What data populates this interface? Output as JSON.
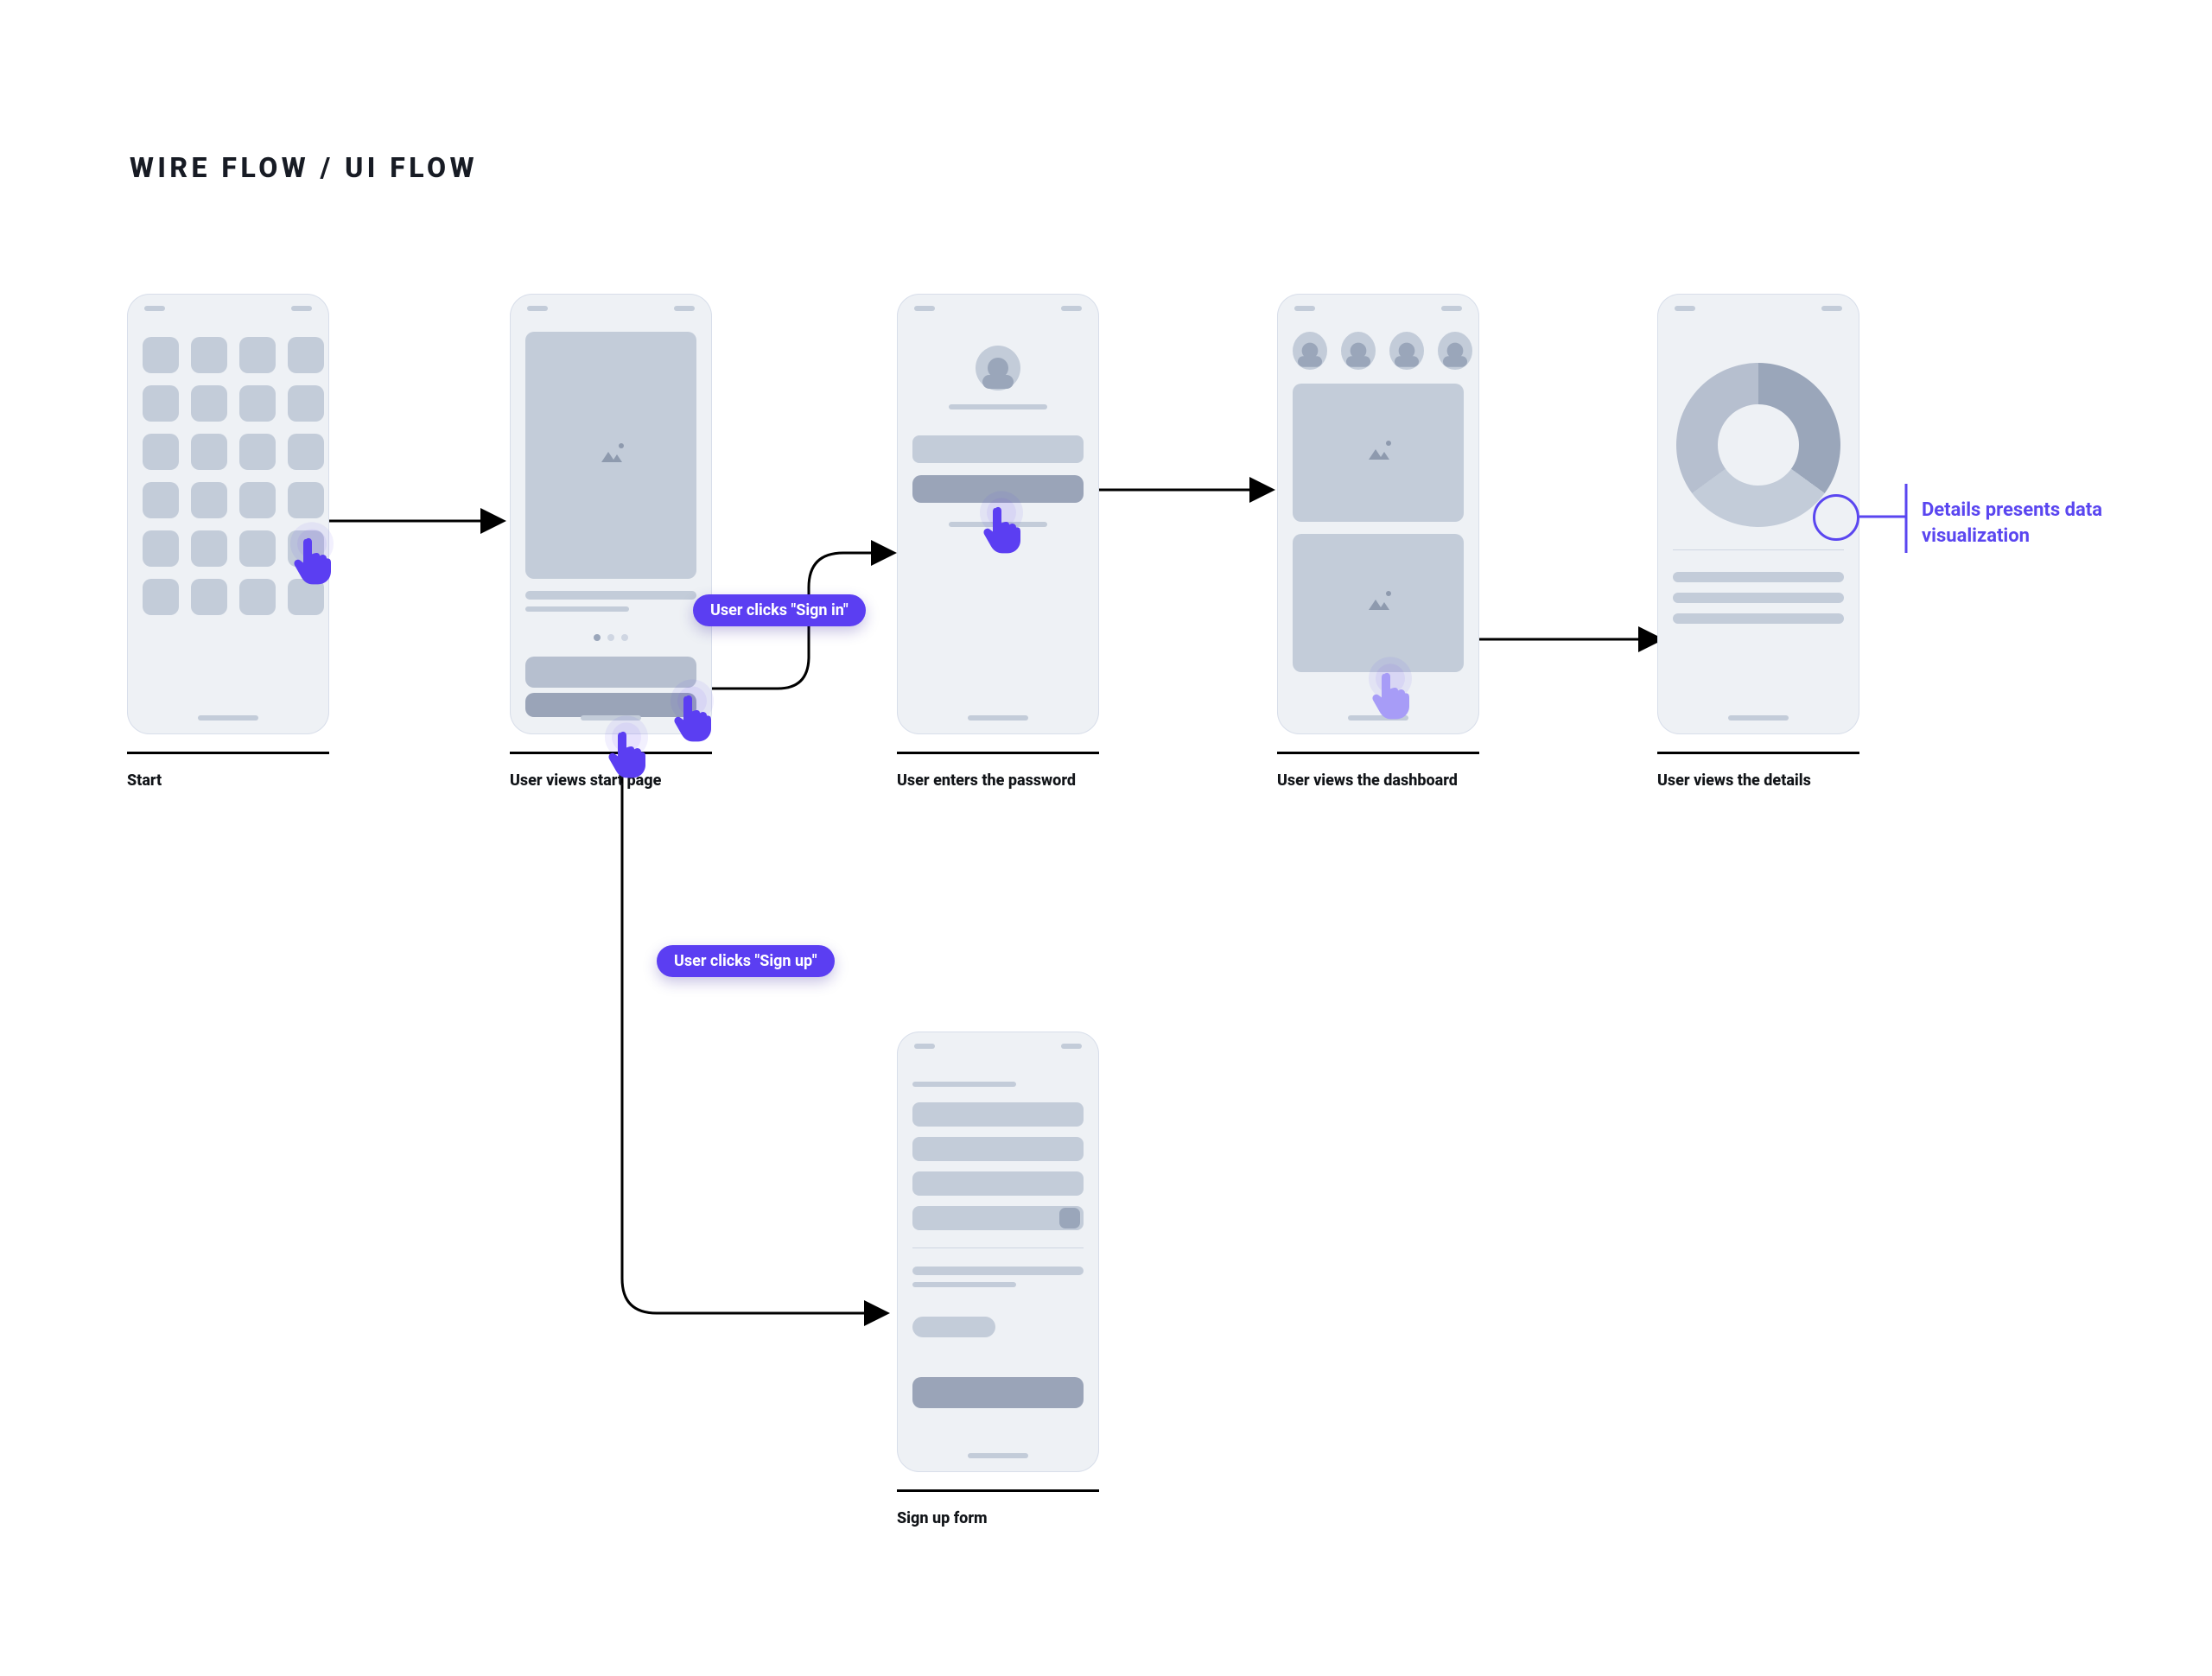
{
  "title": "WIRE FLOW / UI FLOW",
  "chips": {
    "signin": "User clicks \"Sign in\"",
    "signup": "User clicks \"Sign up\""
  },
  "annotation": "Details presents data visualization",
  "captions": {
    "start": "Start",
    "views_start": "User views start page",
    "enter_pw": "User enters the password",
    "dashboard": "User views  the dashboard",
    "details": "User views  the details",
    "signup_form": "Sign up form"
  },
  "colors": {
    "accent": "#5b3ef2",
    "wire": "#c3ccd9"
  }
}
